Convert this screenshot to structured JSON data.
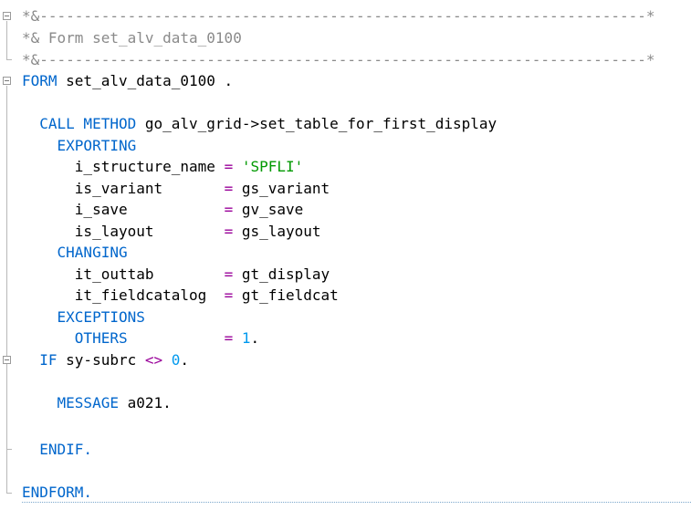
{
  "comment_lines": [
    "*&---------------------------------------------------------------------*",
    "*& Form set_alv_data_0100",
    "*&---------------------------------------------------------------------*"
  ],
  "form_line": {
    "keyword": "FORM",
    "name": " set_alv_data_0100 ."
  },
  "call_line": {
    "keyword": "CALL METHOD",
    "target": " go_alv_grid->set_table_for_first_display"
  },
  "exporting": {
    "keyword": "EXPORTING",
    "params": [
      {
        "name": "i_structure_name",
        "equals": "=",
        "value": "'SPFLI'"
      },
      {
        "name": "is_variant      ",
        "equals": "=",
        "value": "gs_variant"
      },
      {
        "name": "i_save          ",
        "equals": "=",
        "value": "gv_save"
      },
      {
        "name": "is_layout       ",
        "equals": "=",
        "value": "gs_layout"
      }
    ]
  },
  "changing": {
    "keyword": "CHANGING",
    "params": [
      {
        "name": "it_outtab       ",
        "equals": "=",
        "value": "gt_display"
      },
      {
        "name": "it_fieldcatalog ",
        "equals": "=",
        "value": "gt_fieldcat"
      }
    ]
  },
  "exceptions": {
    "keyword": "EXCEPTIONS",
    "others": "OTHERS",
    "equals": "=",
    "value": "1",
    "terminator": "."
  },
  "if_line": {
    "keyword": "IF",
    "field": " sy-subrc ",
    "operator": "<>",
    "value": "0",
    "terminator": "."
  },
  "message_line": {
    "keyword": "MESSAGE",
    "value": " a021."
  },
  "endif_line": "ENDIF.",
  "endform_line": "ENDFORM.",
  "colors": {
    "keyword": "#0066cc",
    "comment": "#8a8a8a",
    "string": "#009900",
    "number": "#0099ee",
    "operator": "#990099"
  }
}
